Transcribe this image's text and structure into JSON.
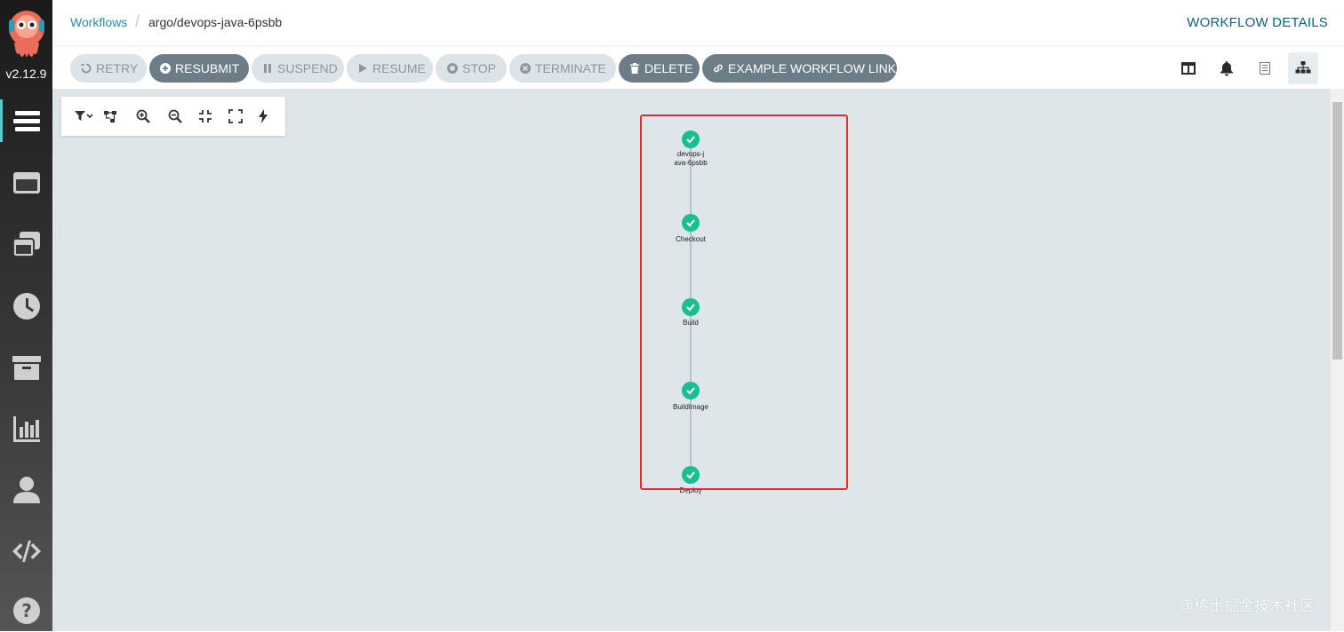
{
  "app": {
    "version": "v2.12.9"
  },
  "breadcrumb": {
    "workflows": "Workflows",
    "name": "argo/devops-java-6psbb"
  },
  "page": {
    "title": "WORKFLOW DETAILS"
  },
  "toolbar": {
    "retry": "RETRY",
    "resubmit": "RESUBMIT",
    "suspend": "SUSPEND",
    "resume": "RESUME",
    "stop": "STOP",
    "terminate": "TERMINATE",
    "delete": "DELETE",
    "example_link": "EXAMPLE WORKFLOW LINK"
  },
  "sidebar": {
    "items": [
      "workflows-icon",
      "templates-icon",
      "cluster-templates-icon",
      "cron-icon",
      "archive-icon",
      "reports-icon",
      "user-icon",
      "api-docs-icon",
      "help-icon"
    ]
  },
  "graph": {
    "nodes": [
      {
        "label": "devops-j\nava-6psbb",
        "status": "Succeeded"
      },
      {
        "label": "Checkout",
        "status": "Succeeded"
      },
      {
        "label": "Build",
        "status": "Succeeded"
      },
      {
        "label": "BuildImage",
        "status": "Succeeded"
      },
      {
        "label": "Deploy",
        "status": "Succeeded"
      }
    ],
    "success_color": "#18be94"
  },
  "watermark": "@稀土掘金技术社区"
}
